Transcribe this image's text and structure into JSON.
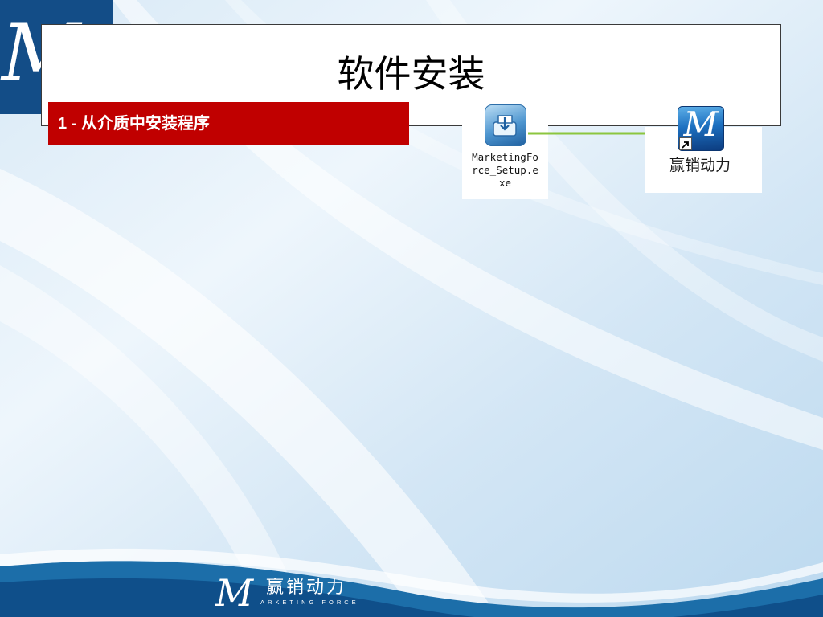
{
  "slide": {
    "title": "软件安装",
    "section": "1 - 从介质中安装程序"
  },
  "setup_file": {
    "icon": "installer-icon",
    "label": "MarketingFo\nrce_Setup.e\nxe"
  },
  "shortcut": {
    "icon": "marketing-force-app-icon",
    "overlay": "shortcut-arrow-icon",
    "label": "赢销动力"
  },
  "brand": {
    "logo_glyph": "M",
    "name_cn": "赢销动力",
    "name_en": "ARKETING FORCE"
  },
  "colors": {
    "section_bar": "#c00000",
    "brand_blue": "#134d87",
    "arrow": "#8cc63f"
  }
}
